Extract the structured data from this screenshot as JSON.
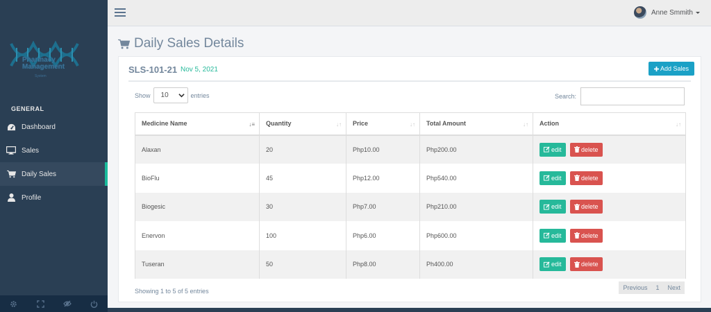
{
  "sidebar": {
    "logo_title": "Pharmacy Management",
    "logo_subtitle": "System",
    "section_label": "GENERAL",
    "items": [
      {
        "label": "Dashboard",
        "icon": "dashboard-icon"
      },
      {
        "label": "Sales",
        "icon": "desktop-icon"
      },
      {
        "label": "Daily Sales",
        "icon": "cart-icon"
      },
      {
        "label": "Profile",
        "icon": "user-icon"
      }
    ],
    "active_item": "Daily Sales",
    "footer_icons": [
      "gear-icon",
      "fullscreen-icon",
      "eye-slash-icon",
      "power-icon"
    ]
  },
  "topnav": {
    "user_name": "Anne Smmith"
  },
  "page": {
    "title": "Daily Sales Details"
  },
  "panel": {
    "sale_code": "SLS-101-21",
    "sale_date": "Nov 5, 2021",
    "add_button": "Add Sales"
  },
  "table_controls": {
    "show_label": "Show",
    "entries_value": "10",
    "entries_label": "entries",
    "search_label": "Search:",
    "search_value": ""
  },
  "table": {
    "columns": [
      "Medicine Name",
      "Quantity",
      "Price",
      "Total Amount",
      "Action"
    ],
    "rows": [
      {
        "name": "Alaxan",
        "quantity": "20",
        "price": "Php10.00",
        "total": "Php200.00"
      },
      {
        "name": "BioFlu",
        "quantity": "45",
        "price": "Php12.00",
        "total": "Php540.00"
      },
      {
        "name": "Biogesic",
        "quantity": "30",
        "price": "Php7.00",
        "total": "Php210.00"
      },
      {
        "name": "Enervon",
        "quantity": "100",
        "price": "Php6.00",
        "total": "Php600.00"
      },
      {
        "name": "Tuseran",
        "quantity": "50",
        "price": "Php8.00",
        "total": "Ph400.00"
      }
    ],
    "edit_label": "edit",
    "delete_label": "delete"
  },
  "footer": {
    "info": "Showing 1 to 5 of 5 entries",
    "prev": "Previous",
    "page": "1",
    "next": "Next"
  },
  "colors": {
    "sidebar": "#2a3f54",
    "accent_green": "#26b99a",
    "accent_blue": "#1ba1c6",
    "danger": "#d9534f"
  }
}
